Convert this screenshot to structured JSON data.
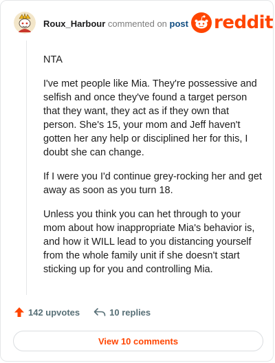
{
  "header": {
    "username": "Roux_Harbour",
    "action_text": "commented on",
    "post_link": "post",
    "brand": "reddit"
  },
  "comment": {
    "paragraphs": [
      "NTA",
      "I've met people like Mia. They're possessive and selfish and once they've found a target person that they want, they act as if they own that person. She's 15, your mom and Jeff haven't gotten her any help or disciplined her for this, I doubt she can change.",
      "If I were you I'd continue grey-rocking her and get away as soon as you turn 18.",
      "Unless you think you can het through to your mom about how inappropriate Mia's behavior is, and how it WILL lead to you distancing yourself from the whole family unit if she doesn't start sticking up for you and controlling Mia."
    ]
  },
  "actions": {
    "upvotes": "142 upvotes",
    "replies": "10 replies"
  },
  "footer": {
    "view_comments": "View 10 comments"
  },
  "colors": {
    "brand": "#ff4500",
    "link": "#0f4c81",
    "muted": "#576f76"
  },
  "icons": {
    "avatar": "snoo-avatar",
    "logo": "reddit-alien-icon",
    "upvote": "upvote-arrow-icon",
    "reply": "reply-arrow-icon"
  }
}
